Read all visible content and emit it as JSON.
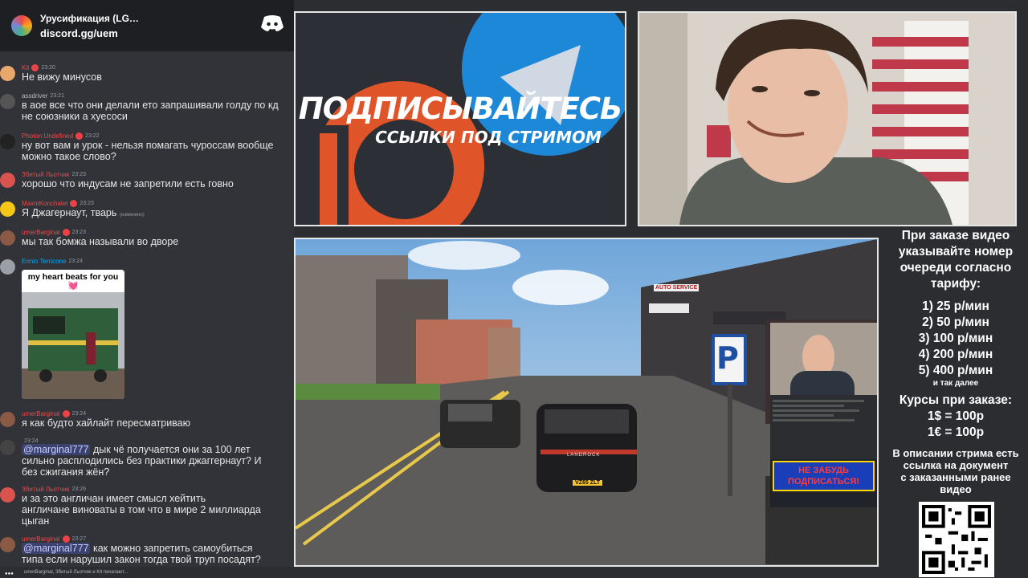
{
  "server": {
    "name": "Урусификация (LG…",
    "invite": "discord.gg/uem"
  },
  "messages": [
    {
      "user": "Kit",
      "user_color": "#f04747",
      "time": "23:20",
      "lines": [
        "Не вижу минусов"
      ]
    },
    {
      "user": "assdriver",
      "user_color": "#b5bac1",
      "time": "23:21",
      "lines": [
        "в аое все что они делали ето запрашивали голду по кд",
        "не союзники а хуесоси"
      ]
    },
    {
      "user": "Photon Undefined",
      "user_color": "#f04747",
      "time": "23:22",
      "lines": [
        "ну вот вам и урок - нельзя помагать чуроссам вообще",
        "можно такое слово?"
      ]
    },
    {
      "user": "Збитый Льотчик",
      "user_color": "#f04747",
      "time": "23:23",
      "lines": [
        "хорошо что индусам не запретили есть говно"
      ]
    },
    {
      "user": "MaxmKonchatel",
      "user_color": "#f04747",
      "time": "23:23",
      "lines": [
        "Я Джагернаут, тварь"
      ],
      "edited": "(изменено)"
    },
    {
      "user": "umerBarginal",
      "user_color": "#f04747",
      "time": "23:23",
      "lines": [
        "мы так бомжа называли во дворе"
      ]
    },
    {
      "user": "Ennio Terricone",
      "user_color": "#00a8fc",
      "time": "23:24",
      "lines": []
    },
    {
      "user": "umerBarginal",
      "user_color": "#f04747",
      "time": "23:24",
      "lines": [
        "я как будто хайлайт пересматриваю"
      ]
    },
    {
      "user": "",
      "user_color": "#b5bac1",
      "time": "23:24",
      "mention": "@marginal777",
      "lines": [
        "дык чё получается они за 100 лет",
        "сильно расплодились без практики джаггернаут? И",
        "без сжигания жён?"
      ]
    },
    {
      "user": "Збитый Льотчик",
      "user_color": "#f04747",
      "time": "23:26",
      "lines": [
        "и за это англичан имеет смысл хейтить",
        "англичане виноваты в том что в мире 2 миллиарда",
        "цыган"
      ]
    },
    {
      "user": "umerBarginal",
      "user_color": "#f04747",
      "time": "23:27",
      "mention": "@marginal777",
      "lines": [
        "как можно запретить самоубиться",
        "типа если нарушил закон тогда твой труп посадят?"
      ]
    }
  ],
  "attachment": {
    "caption": "my heart beats for you 💓"
  },
  "typing": "umerBarginal, Збитый Льотчик и Kit печатают...",
  "promo": {
    "title": "ПОДПИСЫВАЙТЕСЬ",
    "subtitle": "ССЫЛКИ ПОД СТРИМОМ"
  },
  "game": {
    "car_brand": "LANDROCK",
    "plate": "VZ65 ZLT",
    "sign": "AUTO SERVICE",
    "overlay_banner": "НЕ ЗАБУДЬ ПОДПИСАТЬСЯ!"
  },
  "sidebar": {
    "intro": [
      "При заказе видео",
      "указывайте номер",
      "очереди согласно",
      "тарифу:"
    ],
    "rates": [
      "1) 25 р/мин",
      "2) 50 р/мин",
      "3) 100 р/мин",
      "4) 200 р/мин",
      "5) 400 р/мин"
    ],
    "and_so_on": "и так далее",
    "courses_title": "Курсы при заказе:",
    "courses": [
      "1$ = 100р",
      "1€ = 100р"
    ],
    "footer": [
      "В описании стрима есть",
      "ссылка на документ",
      "с заказанными ранее",
      "видео"
    ]
  },
  "colors": {
    "accent_blue": "#1e88d8",
    "patreon_orange": "#e0542a",
    "discord_bg": "#313338"
  }
}
